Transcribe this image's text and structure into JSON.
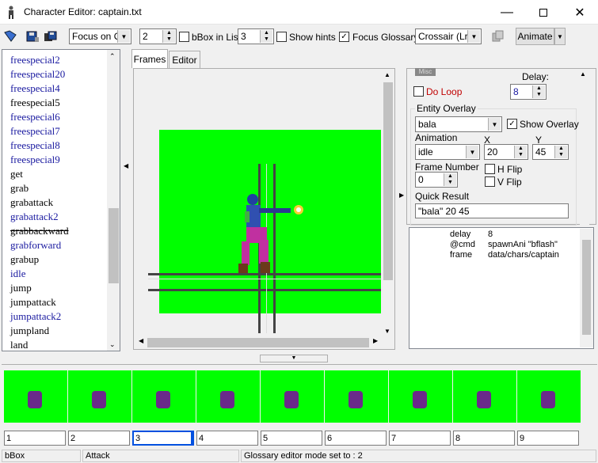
{
  "window": {
    "title": "Character Editor: captain.txt"
  },
  "toolbar": {
    "focus_mode": "Focus on Of",
    "spin1": "2",
    "bbox_label": "bBox in List",
    "spin2": "3",
    "show_hints_label": "Show hints",
    "focus_glossary_label": "Focus Glossary",
    "crosshair_value": "Crossair (Lrg)",
    "animate_label": "Animate"
  },
  "animations": [
    {
      "label": "freespecial2",
      "style": "link"
    },
    {
      "label": "freespecial20",
      "style": "link"
    },
    {
      "label": "freespecial4",
      "style": "link"
    },
    {
      "label": "freespecial5",
      "style": "plain"
    },
    {
      "label": "freespecial6",
      "style": "link"
    },
    {
      "label": "freespecial7",
      "style": "link"
    },
    {
      "label": "freespecial8",
      "style": "link"
    },
    {
      "label": "freespecial9",
      "style": "link"
    },
    {
      "label": "get",
      "style": "plain"
    },
    {
      "label": "grab",
      "style": "plain"
    },
    {
      "label": "grabattack",
      "style": "plain"
    },
    {
      "label": "grabattack2",
      "style": "link"
    },
    {
      "label": "grabbackward",
      "style": "strike"
    },
    {
      "label": "grabforward",
      "style": "link"
    },
    {
      "label": "grabup",
      "style": "plain"
    },
    {
      "label": "idle",
      "style": "link"
    },
    {
      "label": "jump",
      "style": "plain"
    },
    {
      "label": "jumpattack",
      "style": "plain"
    },
    {
      "label": "jumpattack2",
      "style": "link"
    },
    {
      "label": "jumpland",
      "style": "plain"
    },
    {
      "label": "land",
      "style": "plain"
    }
  ],
  "tabs": {
    "frames": "Frames",
    "editor": "Editor"
  },
  "right_panel": {
    "misc_badge": "Misc",
    "delay_label": "Delay:",
    "delay_value": "8",
    "do_loop_label": "Do Loop",
    "entity_overlay_label": "Entity Overlay",
    "entity_value": "bala",
    "show_overlay_label": "Show Overlay",
    "animation_label": "Animation",
    "animation_value": "idle",
    "x_label": "X",
    "x_value": "20",
    "y_label": "Y",
    "y_value": "45",
    "frame_number_label": "Frame Number",
    "frame_number_value": "0",
    "hflip_label": "H Flip",
    "vflip_label": "V Flip",
    "quick_result_label": "Quick Result",
    "quick_result_value": "\"bala\" 20 45"
  },
  "properties": [
    {
      "key": "delay",
      "value": "8"
    },
    {
      "key": "@cmd",
      "value": "spawnAni \"bflash\""
    },
    {
      "key": "frame",
      "value": "data/chars/captain"
    }
  ],
  "frames": [
    "1",
    "2",
    "3",
    "4",
    "5",
    "6",
    "7",
    "8",
    "9"
  ],
  "status": {
    "seg1": "bBox",
    "seg2": "Attack",
    "seg3": "Glossary editor mode set to : 2"
  },
  "colors": {
    "link": "#1a1aa0",
    "green": "#00ff00",
    "accent": "#0050e0"
  }
}
